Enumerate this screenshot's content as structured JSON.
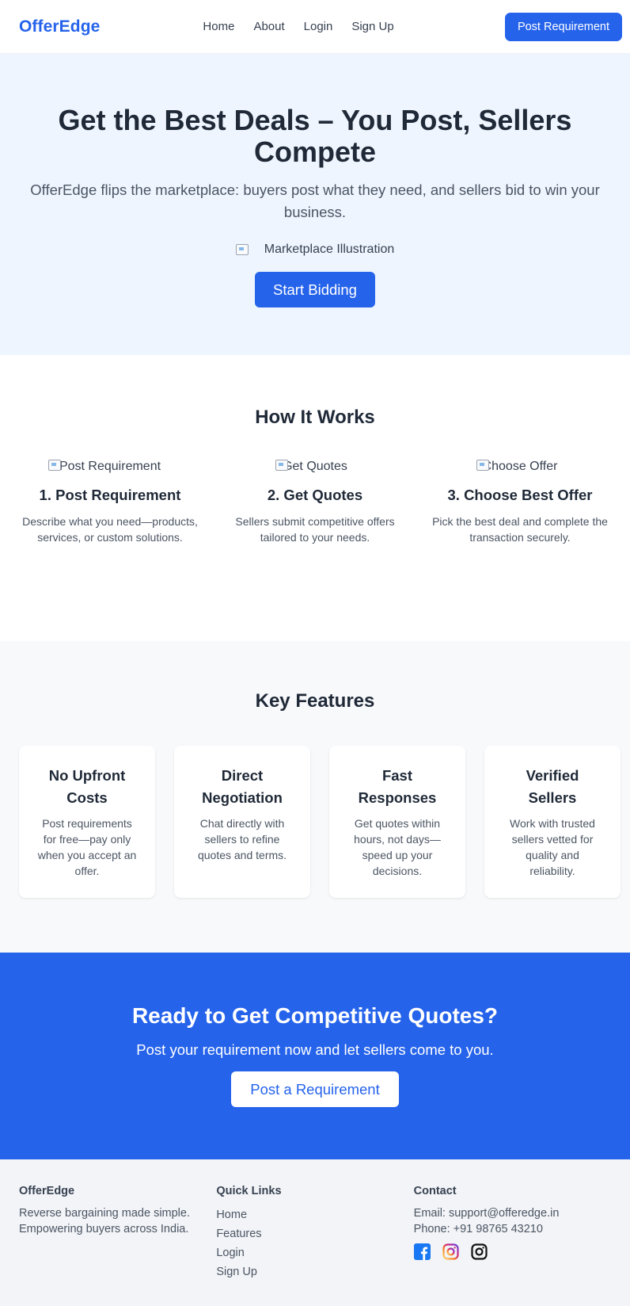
{
  "nav": {
    "brand": "OfferEdge",
    "links": [
      "Home",
      "About",
      "Login",
      "Sign Up"
    ],
    "cta": "Post Requirement"
  },
  "hero": {
    "title": "Get the Best Deals – You Post, Sellers Compete",
    "subtitle": "OfferEdge flips the marketplace: buyers post what they need, and sellers bid to win your business.",
    "image_alt": "Marketplace Illustration",
    "cta": "Start Bidding"
  },
  "how": {
    "title": "How It Works",
    "steps": [
      {
        "image_alt": "Post Requirement",
        "title": "1. Post Requirement",
        "text": "Describe what you need—products, services, or custom solutions."
      },
      {
        "image_alt": "Get Quotes",
        "title": "2. Get Quotes",
        "text": "Sellers submit competitive offers tailored to your needs."
      },
      {
        "image_alt": "Choose Offer",
        "title": "3. Choose Best Offer",
        "text": "Pick the best deal and complete the transaction securely."
      }
    ]
  },
  "features": {
    "title": "Key Features",
    "cards": [
      {
        "title": "No Upfront Costs",
        "text": "Post requirements for free—pay only when you accept an offer."
      },
      {
        "title": "Direct Negotiation",
        "text": "Chat directly with sellers to refine quotes and terms."
      },
      {
        "title": "Fast Responses",
        "text": "Get quotes within hours, not days—speed up your decisions."
      },
      {
        "title": "Verified Sellers",
        "text": "Work with trusted sellers vetted for quality and reliability."
      }
    ]
  },
  "cta": {
    "title": "Ready to Get Competitive Quotes?",
    "subtitle": "Post your requirement now and let sellers come to you.",
    "button": "Post a Requirement"
  },
  "footer": {
    "brand": {
      "title": "OfferEdge",
      "text": "Reverse bargaining made simple. Empowering buyers across India."
    },
    "quick_links": {
      "title": "Quick Links",
      "items": [
        "Home",
        "Features",
        "Login",
        "Sign Up"
      ]
    },
    "contact": {
      "title": "Contact",
      "email": "Email: support@offeredge.in",
      "phone": "Phone: +91 98765 43210",
      "socials": [
        "facebook-icon",
        "instagram-icon",
        "instagram-outline-icon"
      ]
    }
  },
  "colors": {
    "primary": "#2563eb",
    "hero_bg": "#eef5ff",
    "features_bg": "#f8f9fb",
    "footer_bg": "#f2f4f7"
  }
}
